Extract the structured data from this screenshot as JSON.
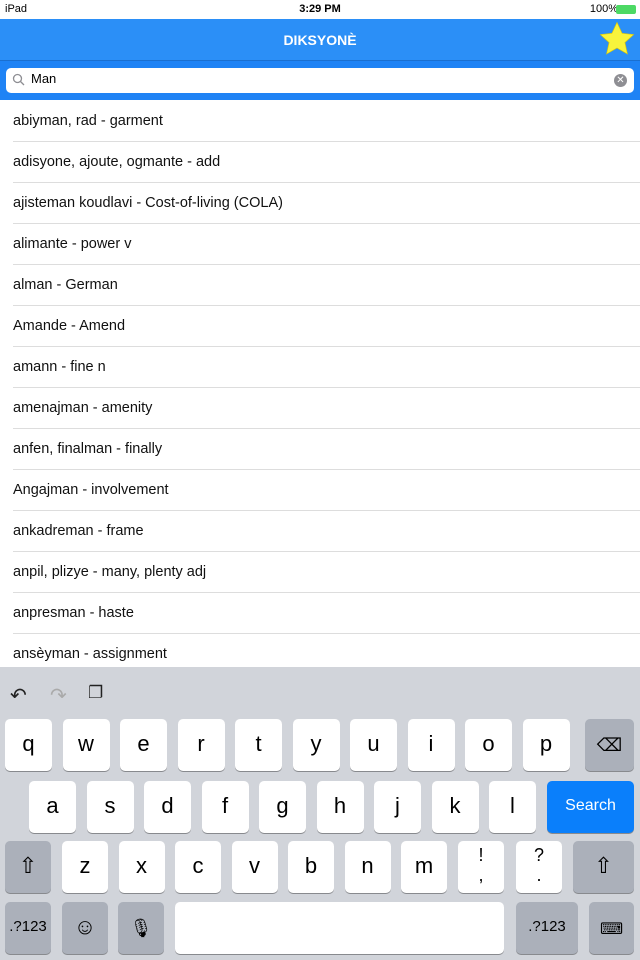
{
  "status": {
    "device": "iPad",
    "time": "3:29 PM",
    "battery": "100%"
  },
  "header": {
    "title": "DIKSYONÈ",
    "favorite_icon": "star-icon",
    "star_color": "#f8f43c"
  },
  "search": {
    "value": "Man",
    "placeholder": ""
  },
  "results": [
    "abiyman, rad - garment",
    "adisyone, ajoute, ogmante - add",
    "ajisteman koudlavi - Cost-of-living (COLA)",
    "alimante - power v",
    "alman - German",
    "Amande - Amend",
    "amann - fine n",
    "amenajman - amenity",
    "anfen, finalman - finally",
    "Angajman - involvement",
    "ankadreman - frame",
    "anpil, plizye - many, plenty adj",
    "anpresman - haste",
    "ansèyman - assignment"
  ],
  "keyboard": {
    "row1": [
      "q",
      "w",
      "e",
      "r",
      "t",
      "y",
      "u",
      "i",
      "o",
      "p"
    ],
    "row2": [
      "a",
      "s",
      "d",
      "f",
      "g",
      "h",
      "j",
      "k",
      "l"
    ],
    "row3": [
      "z",
      "x",
      "c",
      "v",
      "b",
      "n",
      "m"
    ],
    "punct1": "!\n,",
    "punct2": "?\n.",
    "search_label": "Search",
    "numbers_label": ".?123",
    "accent_color": "#0a7ffb"
  }
}
